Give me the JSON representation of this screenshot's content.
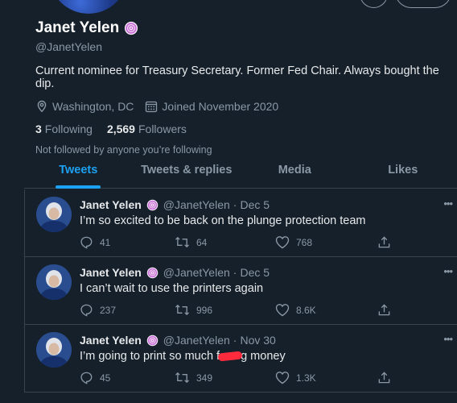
{
  "profile": {
    "name": "Janet Yelen",
    "handle": "@JanetYelen",
    "bio": "Current nominee for Treasury Secretary. Former Fed Chair. Always bought the dip.",
    "location": "Washington, DC",
    "joined": "Joined November 2020",
    "following_count": "3",
    "following_label": "Following",
    "followers_count": "2,569",
    "followers_label": "Followers",
    "followed_note": "Not followed by anyone you’re following"
  },
  "tabs": [
    {
      "label": "Tweets",
      "active": true
    },
    {
      "label": "Tweets & replies",
      "active": false
    },
    {
      "label": "Media",
      "active": false
    },
    {
      "label": "Likes",
      "active": false
    }
  ],
  "tweets": [
    {
      "name": "Janet Yelen",
      "handle": "@JanetYelen",
      "separator": "·",
      "date": "Dec 5",
      "text": "I’m so excited to be back on the plunge protection team",
      "replies": "41",
      "retweets": "64",
      "likes": "768"
    },
    {
      "name": "Janet Yelen",
      "handle": "@JanetYelen",
      "separator": "·",
      "date": "Dec 5",
      "text": "I can’t wait to use the printers again",
      "replies": "237",
      "retweets": "996",
      "likes": "8.6K"
    },
    {
      "name": "Janet Yelen",
      "handle": "@JanetYelen",
      "separator": "·",
      "date": "Nov 30",
      "text_before": "I’m going to print so much f",
      "text_after": "g money",
      "replies": "45",
      "retweets": "349",
      "likes": "1.3K"
    }
  ],
  "colors": {
    "background": "#15202b",
    "accent": "#1da1f2",
    "muted": "#8b98a5",
    "border": "#38444d",
    "redaction": "#ff2b3d"
  }
}
